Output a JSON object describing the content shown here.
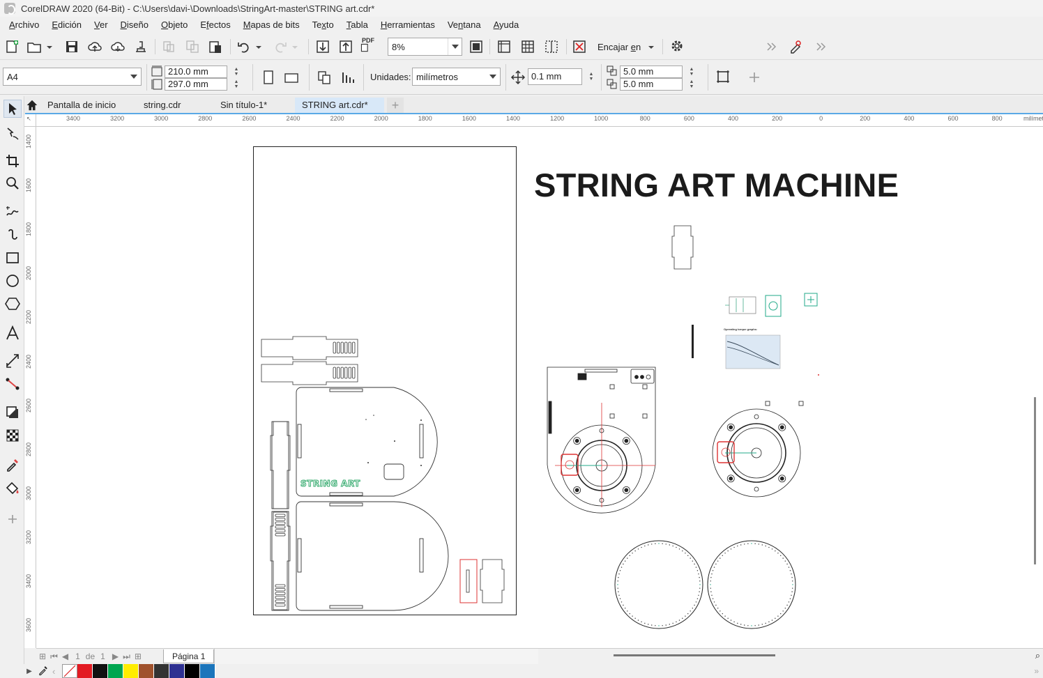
{
  "window": {
    "title": "CorelDRAW 2020 (64-Bit) - C:\\Users\\davi-\\Downloads\\StringArt-master\\STRING art.cdr*"
  },
  "menu": {
    "items": [
      {
        "pre": "",
        "ul": "A",
        "post": "rchivo"
      },
      {
        "pre": "",
        "ul": "E",
        "post": "dición"
      },
      {
        "pre": "",
        "ul": "V",
        "post": "er"
      },
      {
        "pre": "",
        "ul": "D",
        "post": "iseño"
      },
      {
        "pre": "",
        "ul": "O",
        "post": "bjeto"
      },
      {
        "pre": "E",
        "ul": "f",
        "post": "ectos"
      },
      {
        "pre": "",
        "ul": "M",
        "post": "apas de bits"
      },
      {
        "pre": "Te",
        "ul": "x",
        "post": "to"
      },
      {
        "pre": "",
        "ul": "T",
        "post": "abla"
      },
      {
        "pre": "",
        "ul": "H",
        "post": "erramientas"
      },
      {
        "pre": "Ve",
        "ul": "n",
        "post": "tana"
      },
      {
        "pre": "",
        "ul": "A",
        "post": "yuda"
      }
    ]
  },
  "toolbar": {
    "zoom_value": "8%",
    "pdf_label": "PDF",
    "fit_label_pre": "Encajar ",
    "fit_label_ul": "e",
    "fit_label_post": "n"
  },
  "property_bar": {
    "page_size": "A4",
    "width": "210.0 mm",
    "height": "297.0 mm",
    "units_label": "Unidades:",
    "units_value": "milímetros",
    "nudge": "0.1 mm",
    "dup_x": "5.0 mm",
    "dup_y": "5.0 mm"
  },
  "tabs": [
    {
      "label": "Pantalla de inicio",
      "active": false
    },
    {
      "label": "string.cdr",
      "active": false
    },
    {
      "label": "Sin título-1*",
      "active": false
    },
    {
      "label": "STRING art.cdr*",
      "active": true
    }
  ],
  "ruler": {
    "h_labels": [
      "3400",
      "3200",
      "3000",
      "2800",
      "2600",
      "2400",
      "2200",
      "2000",
      "1800",
      "1600",
      "1400",
      "1200",
      "1000",
      "800",
      "600",
      "400",
      "200",
      "0",
      "200",
      "400",
      "600",
      "800"
    ],
    "units": "milímetros",
    "v_labels": [
      "1400",
      "1600",
      "1800",
      "2000",
      "2200",
      "2400",
      "2600",
      "2800",
      "3000",
      "3200",
      "3400",
      "3600"
    ]
  },
  "canvas": {
    "title": "STRING ART MACHINE",
    "logo_text": "STRING ART",
    "chart_caption": "Operating torque graphs:"
  },
  "page_nav": {
    "current": "1",
    "of": "de",
    "total": "1",
    "page_tab": "Página 1"
  },
  "palette": {
    "colors": [
      "#e31b23",
      "#111111",
      "#00a650",
      "#ffed00",
      "#a0522d",
      "#333333",
      "#2e3192",
      "#000000",
      "#1b75bb"
    ]
  }
}
